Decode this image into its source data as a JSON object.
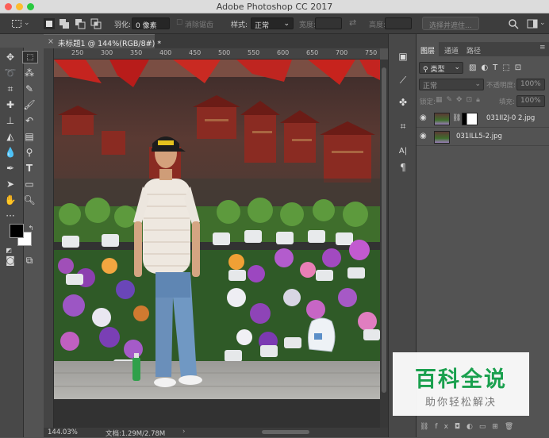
{
  "app": {
    "title": "Adobe Photoshop CC 2017"
  },
  "options_bar": {
    "feather_label": "羽化:",
    "feather_value": "0 像素",
    "antialias_label": "消除锯齿",
    "style_label": "样式:",
    "style_value": "正常",
    "width_label": "宽度:",
    "height_label": "高度:",
    "select_mask_button": "选择并遮住..."
  },
  "document": {
    "tab_label": "未标题1 @ 144%(RGB/8#) *",
    "ruler_ticks": [
      "250",
      "300",
      "350",
      "400",
      "450",
      "500",
      "550",
      "600",
      "650",
      "700",
      "750"
    ]
  },
  "status": {
    "zoom": "144.03%",
    "doc_info": "文档:1.29M/2.78M"
  },
  "panel": {
    "tabs": [
      "图层",
      "通道",
      "路径"
    ],
    "kind_filter": "类型",
    "blend_mode": "正常",
    "opacity_label": "不透明度:",
    "opacity_value": "100%",
    "lock_label": "锁定:",
    "fill_label": "填充:",
    "fill_value": "100%",
    "layers": [
      {
        "name": "031II2J-0 2.jpg",
        "has_mask": true
      },
      {
        "name": "031ILL5-2.jpg",
        "has_mask": false
      }
    ]
  },
  "watermark": {
    "title": "百科全说",
    "subtitle": "助你轻松解决"
  },
  "colors": {
    "foreground": "#000000",
    "background": "#ffffff",
    "accent_green": "#1aa04e"
  }
}
